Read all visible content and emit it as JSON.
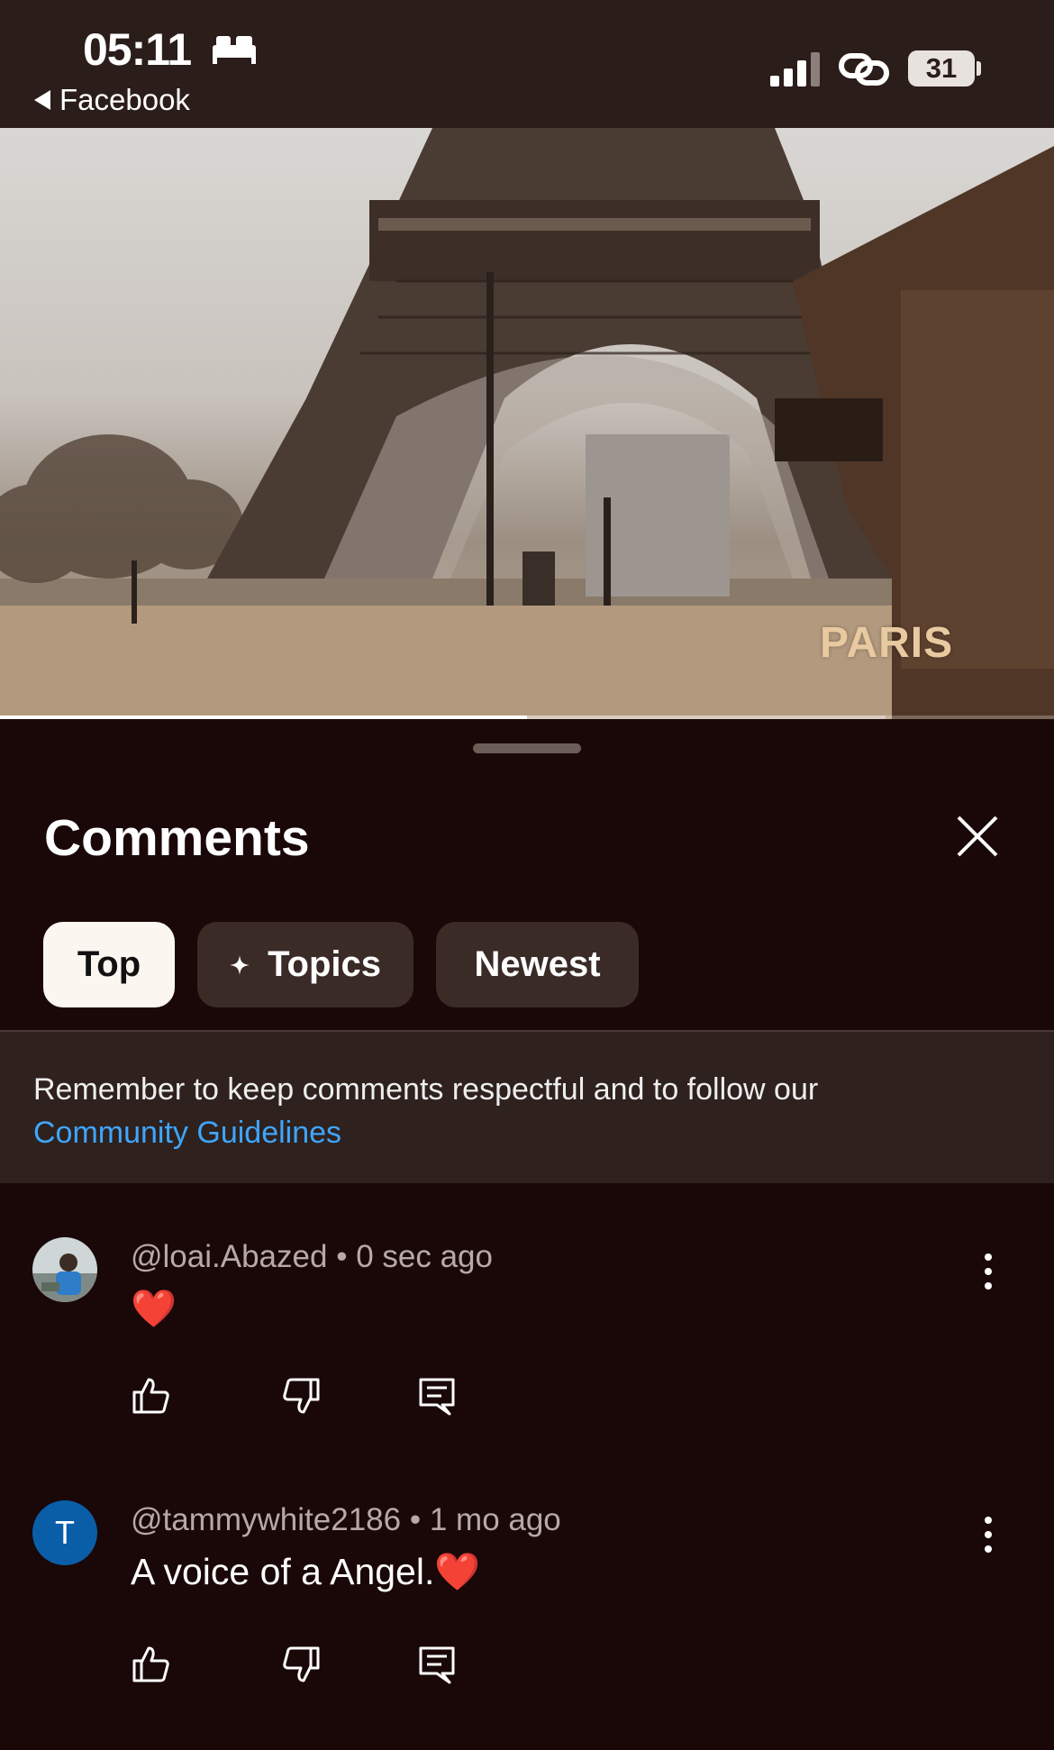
{
  "status_bar": {
    "time": "05:11",
    "back_label": "Facebook",
    "battery": "31",
    "icons": [
      "bed-icon",
      "signal-icon",
      "link-icon",
      "battery-icon"
    ]
  },
  "video": {
    "watermark": "PARIS",
    "progress_fraction": 0.5,
    "buffered_fraction": 0.84
  },
  "comments_sheet": {
    "title": "Comments",
    "filters": [
      {
        "label": "Top",
        "active": true
      },
      {
        "label": "Topics",
        "active": false,
        "icon": "sparkle-icon"
      },
      {
        "label": "Newest",
        "active": false
      }
    ],
    "notice": {
      "text": "Remember to keep comments respectful and to follow our",
      "link": "Community Guidelines"
    },
    "comments": [
      {
        "author": "@loai.Abazed",
        "time": "0 sec ago",
        "separator": "•",
        "text": "❤️",
        "avatar": "photo"
      },
      {
        "author": "@tammywhite2186",
        "time": "1 mo ago",
        "separator": "•",
        "text": "A voice of a Angel.❤️",
        "avatar_letter": "T"
      }
    ]
  },
  "colors": {
    "background": "#1a0808",
    "link": "#3ea6ff",
    "chip": "#3a2b27",
    "chip_active": "#fbf7f0",
    "avatar_t": "#0a5ea8"
  }
}
